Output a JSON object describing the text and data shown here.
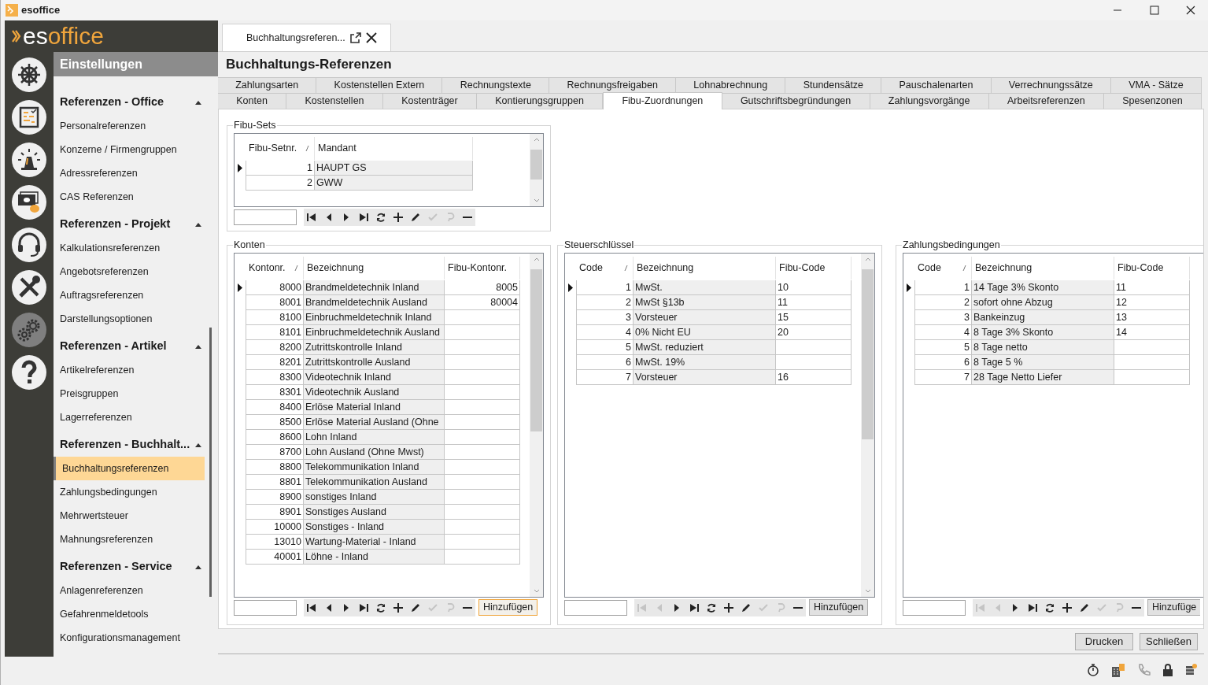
{
  "window": {
    "title": "esoffice"
  },
  "logo": {
    "prefix": "es",
    "suffix": "office"
  },
  "rail": [
    {
      "kind": "wheel",
      "selected": false
    },
    {
      "kind": "board",
      "selected": false
    },
    {
      "kind": "siren",
      "selected": false
    },
    {
      "kind": "cash",
      "selected": false
    },
    {
      "kind": "headset",
      "selected": false
    },
    {
      "kind": "tools",
      "selected": false
    },
    {
      "kind": "gears",
      "selected": true
    },
    {
      "kind": "help",
      "selected": false
    }
  ],
  "sidebar": {
    "header": "Einstellungen",
    "sections": [
      {
        "title": "Referenzen - Office",
        "expanded": true,
        "items": [
          {
            "label": "Personalreferenzen",
            "selected": false
          },
          {
            "label": "Konzerne / Firmengruppen",
            "selected": false
          },
          {
            "label": "Adressreferenzen",
            "selected": false
          },
          {
            "label": "CAS Referenzen",
            "selected": false
          }
        ]
      },
      {
        "title": "Referenzen - Projekt",
        "expanded": true,
        "items": [
          {
            "label": "Kalkulationsreferenzen",
            "selected": false
          },
          {
            "label": "Angebotsreferenzen",
            "selected": false
          },
          {
            "label": "Auftragsreferenzen",
            "selected": false
          },
          {
            "label": "Darstellungsoptionen",
            "selected": false
          }
        ]
      },
      {
        "title": "Referenzen - Artikel",
        "expanded": true,
        "items": [
          {
            "label": "Artikelreferenzen",
            "selected": false
          },
          {
            "label": "Preisgruppen",
            "selected": false
          },
          {
            "label": "Lagerreferenzen",
            "selected": false
          }
        ]
      },
      {
        "title": "Referenzen - Buchhalt...",
        "expanded": true,
        "items": [
          {
            "label": "Buchhaltungsreferenzen",
            "selected": true
          },
          {
            "label": "Zahlungsbedingungen",
            "selected": false
          },
          {
            "label": "Mehrwertsteuer",
            "selected": false
          },
          {
            "label": "Mahnungsreferenzen",
            "selected": false
          }
        ]
      },
      {
        "title": "Referenzen - Service",
        "expanded": true,
        "items": [
          {
            "label": "Anlagenreferenzen",
            "selected": false
          },
          {
            "label": "Gefahrenmeldetools",
            "selected": false
          },
          {
            "label": "Konfigurationsmanagement",
            "selected": false
          }
        ]
      }
    ]
  },
  "document_tab": {
    "label": "Buchhaltungsreferen..."
  },
  "page_title": "Buchhaltungs-Referenzen",
  "tab_rows": [
    [
      {
        "label": "Zahlungsarten",
        "selected": false
      },
      {
        "label": "Kostenstellen Extern",
        "selected": false
      },
      {
        "label": "Rechnungstexte",
        "selected": false
      },
      {
        "label": "Rechnungsfreigaben",
        "selected": false
      },
      {
        "label": "Lohnabrechnung",
        "selected": false
      },
      {
        "label": "Stundensätze",
        "selected": false
      },
      {
        "label": "Pauschalenarten",
        "selected": false
      },
      {
        "label": "Verrechnungssätze",
        "selected": false
      },
      {
        "label": "VMA - Sätze",
        "selected": false
      }
    ],
    [
      {
        "label": "Konten",
        "selected": false
      },
      {
        "label": "Kostenstellen",
        "selected": false
      },
      {
        "label": "Kostenträger",
        "selected": false
      },
      {
        "label": "Kontierungsgruppen",
        "selected": false
      },
      {
        "label": "Fibu-Zuordnungen",
        "selected": true
      },
      {
        "label": "Gutschriftsbegründungen",
        "selected": false
      },
      {
        "label": "Zahlungsvorgänge",
        "selected": false
      },
      {
        "label": "Arbeitsreferenzen",
        "selected": false
      },
      {
        "label": "Spesenzonen",
        "selected": false
      }
    ]
  ],
  "panels": [
    {
      "title": "Fibu-Sets",
      "columns": [
        "Fibu-Setnr.",
        "Mandant"
      ],
      "at_start": false,
      "pending_changes": false,
      "rows": [
        {
          "cells": [
            "1",
            "HAUPT GS"
          ],
          "current": true
        },
        {
          "cells": [
            "2",
            "GWW"
          ],
          "current": false
        }
      ]
    },
    {
      "title": "Konten",
      "columns": [
        "Kontonr.",
        "Bezeichnung",
        "Fibu-Kontonr."
      ],
      "at_start": false,
      "pending_changes": false,
      "add_button": {
        "label": "Hinzufügen",
        "focused": true
      },
      "rows": [
        {
          "cells": [
            "8000",
            "Brandmeldetechnik Inland",
            "8005"
          ],
          "current": true
        },
        {
          "cells": [
            "8001",
            "Brandmeldetechnik Ausland",
            "80004"
          ],
          "current": false
        },
        {
          "cells": [
            "8100",
            "Einbruchmeldetechnik Inland",
            ""
          ],
          "current": false
        },
        {
          "cells": [
            "8101",
            "Einbruchmeldetechnik Ausland",
            ""
          ],
          "current": false
        },
        {
          "cells": [
            "8200",
            "Zutrittskontrolle Inland",
            ""
          ],
          "current": false
        },
        {
          "cells": [
            "8201",
            "Zutrittskontrolle Ausland",
            ""
          ],
          "current": false
        },
        {
          "cells": [
            "8300",
            "Videotechnik Inland",
            ""
          ],
          "current": false
        },
        {
          "cells": [
            "8301",
            "Videotechnik Ausland",
            ""
          ],
          "current": false
        },
        {
          "cells": [
            "8400",
            "Erlöse Material Inland",
            ""
          ],
          "current": false
        },
        {
          "cells": [
            "8500",
            "Erlöse Material Ausland (Ohne",
            ""
          ],
          "current": false
        },
        {
          "cells": [
            "8600",
            "Lohn Inland",
            ""
          ],
          "current": false
        },
        {
          "cells": [
            "8700",
            "Lohn Ausland (Ohne Mwst)",
            ""
          ],
          "current": false
        },
        {
          "cells": [
            "8800",
            "Telekommunikation Inland",
            ""
          ],
          "current": false
        },
        {
          "cells": [
            "8801",
            "Telekommunikation Ausland",
            ""
          ],
          "current": false
        },
        {
          "cells": [
            "8900",
            "sonstiges Inland",
            ""
          ],
          "current": false
        },
        {
          "cells": [
            "8901",
            "Sonstiges Ausland",
            ""
          ],
          "current": false
        },
        {
          "cells": [
            "10000",
            "Sonstiges - Inland",
            ""
          ],
          "current": false
        },
        {
          "cells": [
            "13010",
            "Wartung-Material - Inland",
            ""
          ],
          "current": false
        },
        {
          "cells": [
            "40001",
            "Löhne - Inland",
            ""
          ],
          "current": false
        }
      ]
    },
    {
      "title": "Steuerschlüssel",
      "columns": [
        "Code",
        "Bezeichnung",
        "Fibu-Code"
      ],
      "at_start": true,
      "pending_changes": false,
      "add_button": {
        "label": "Hinzufügen",
        "focused": false
      },
      "rows": [
        {
          "cells": [
            "1",
            "MwSt.",
            "10"
          ],
          "current": true
        },
        {
          "cells": [
            "2",
            "MwSt §13b",
            "11"
          ],
          "current": false
        },
        {
          "cells": [
            "3",
            "Vorsteuer",
            "15"
          ],
          "current": false
        },
        {
          "cells": [
            "4",
            "0% Nicht EU",
            "20"
          ],
          "current": false
        },
        {
          "cells": [
            "5",
            "MwSt. reduziert",
            ""
          ],
          "current": false
        },
        {
          "cells": [
            "6",
            "MwSt. 19%",
            ""
          ],
          "current": false
        },
        {
          "cells": [
            "7",
            "Vorsteuer",
            "16"
          ],
          "current": false
        }
      ]
    },
    {
      "title": "Zahlungsbedingungen",
      "columns": [
        "Code",
        "Bezeichnung",
        "Fibu-Code"
      ],
      "at_start": true,
      "pending_changes": false,
      "add_button": {
        "label": "Hinzufüge",
        "focused": false
      },
      "rows": [
        {
          "cells": [
            "1",
            "14 Tage 3% Skonto",
            "11"
          ],
          "current": true
        },
        {
          "cells": [
            "2",
            "sofort ohne Abzug",
            "12"
          ],
          "current": false
        },
        {
          "cells": [
            "3",
            "Bankeinzug",
            "13"
          ],
          "current": false
        },
        {
          "cells": [
            "4",
            "8 Tage 3% Skonto",
            "14"
          ],
          "current": false
        },
        {
          "cells": [
            "5",
            "8 Tage netto",
            ""
          ],
          "current": false
        },
        {
          "cells": [
            "6",
            "8 Tage 5 %",
            ""
          ],
          "current": false
        },
        {
          "cells": [
            "7",
            "28 Tage Netto Liefer",
            ""
          ],
          "current": false
        }
      ]
    }
  ],
  "buttons": [
    "Drucken",
    "Schließen"
  ]
}
